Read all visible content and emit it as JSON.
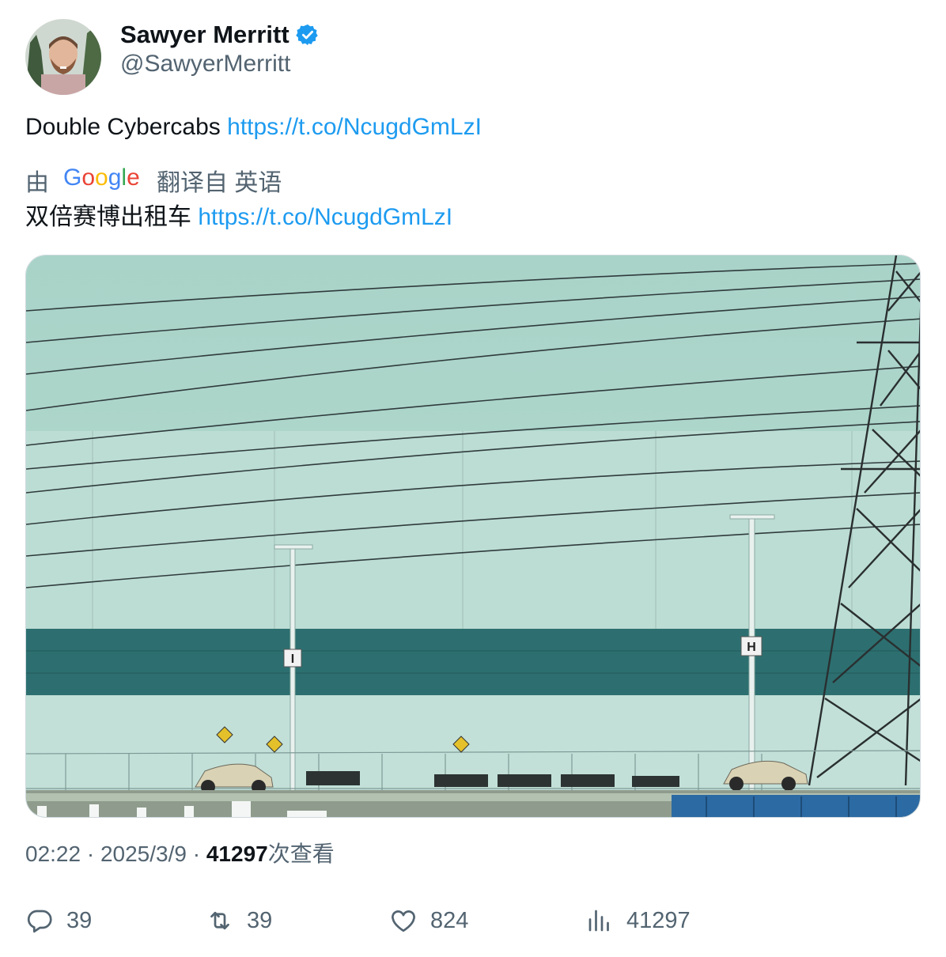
{
  "author": {
    "name": "Sawyer Merritt",
    "handle": "@SawyerMerritt",
    "verified": true
  },
  "tweet": {
    "text": "Double Cybercabs ",
    "link": "https://t.co/NcugdGmLzI"
  },
  "translation": {
    "prefix": "由",
    "provider": "Google",
    "suffix": "翻译自 英语",
    "text": "双倍赛博出租车 ",
    "link": "https://t.co/NcugdGmLzI"
  },
  "media": {
    "sign_left": "I",
    "sign_right": "H"
  },
  "meta": {
    "time": "02:22",
    "sep1": " · ",
    "date": "2025/3/9",
    "sep2": " · ",
    "views": "41297",
    "views_suffix": "次查看"
  },
  "actions": {
    "replies": "39",
    "retweets": "39",
    "likes": "824",
    "views": "41297"
  },
  "colors": {
    "link": "#1d9bf0",
    "secondary": "#536471",
    "verified": "#1d9bf0"
  },
  "icons": [
    "verified-badge-icon",
    "google-logo",
    "reply-icon",
    "retweet-icon",
    "like-icon",
    "views-icon"
  ]
}
